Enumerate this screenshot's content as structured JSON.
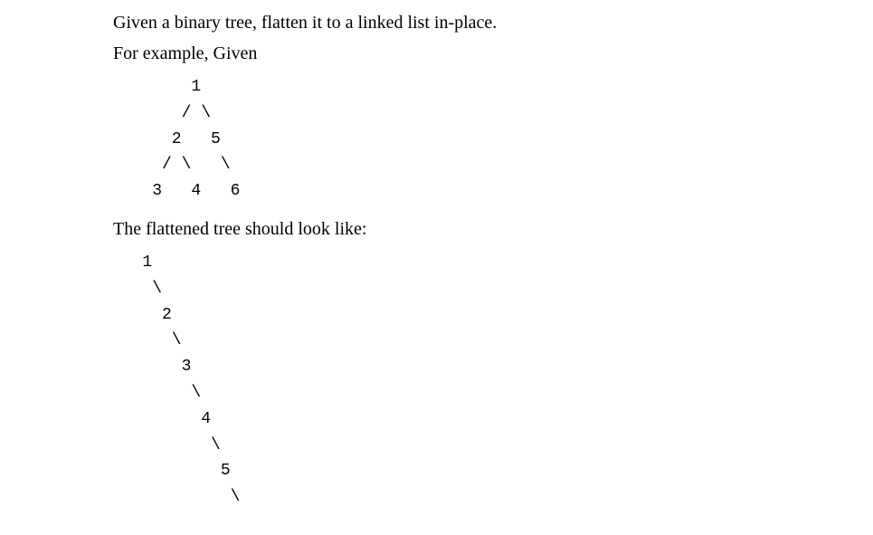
{
  "intro": {
    "line1": "Given a binary tree, flatten it to a linked list in-place.",
    "line2": "For example, Given"
  },
  "tree_input": "        1\n       / \\\n      2   5\n     / \\   \\\n    3   4   6",
  "mid_text": "The flattened tree should look like:",
  "tree_output": "   1\n    \\\n     2\n      \\\n       3\n        \\\n         4\n          \\\n           5\n            \\"
}
